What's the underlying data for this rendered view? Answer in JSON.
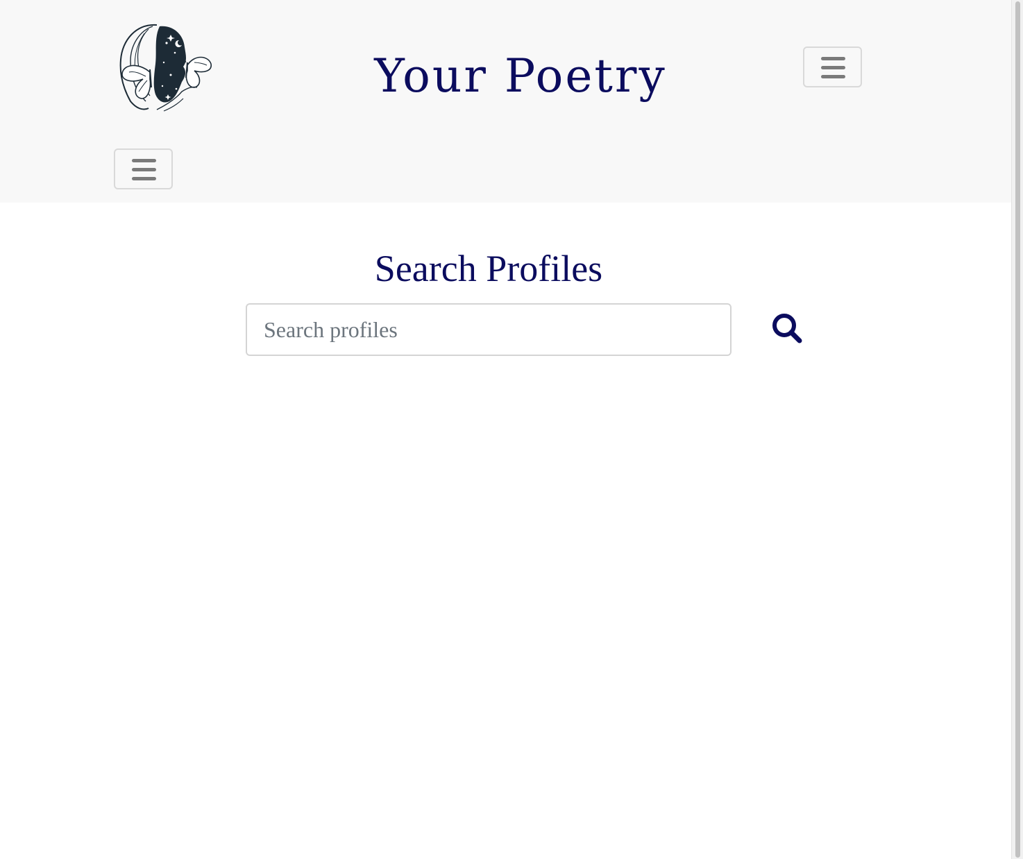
{
  "header": {
    "brand_title": "Your Poetry",
    "logo_icon": "woman-butterfly-logo",
    "menu_toggle_icon": "hamburger-icon"
  },
  "main": {
    "title": "Search Profiles",
    "search": {
      "placeholder": "Search profiles",
      "value": "",
      "icon": "search-icon"
    }
  },
  "colors": {
    "brand": "#0b0c5e",
    "header_background": "#f8f8f8",
    "toggler_border": "#d9d9d9",
    "toggler_bars": "#7a7a7a"
  }
}
